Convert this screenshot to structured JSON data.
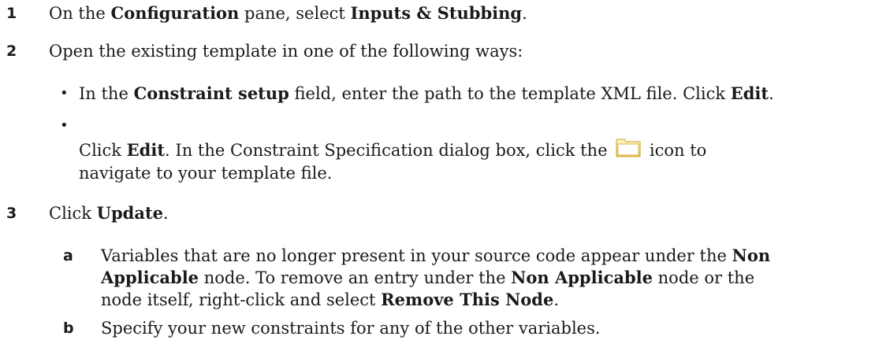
{
  "steps": [
    {
      "number": "1",
      "parts": [
        "On the ",
        "Configuration",
        " pane, select ",
        "Inputs & Stubbing",
        "."
      ]
    },
    {
      "number": "2",
      "text": "Open the existing template in one of the following ways:",
      "bullets": [
        {
          "parts": [
            "In the ",
            "Constraint setup",
            " field, enter the path to the template XML file. Click ",
            "Edit",
            "."
          ]
        },
        {
          "line1": [
            "Click ",
            "Edit",
            ". In the Constraint Specification dialog box, click the ",
            " icon to"
          ],
          "line2": "navigate to your template file."
        }
      ]
    },
    {
      "number": "3",
      "parts": [
        "Click ",
        "Update",
        "."
      ],
      "substeps": [
        {
          "letter": "a",
          "line1": [
            "Variables that are no longer present in your source code appear under the ",
            "Non"
          ],
          "line2": [
            "Applicable",
            " node. To remove an entry under the ",
            "Non Applicable",
            " node or the"
          ],
          "line3": [
            "node itself, right-click and select ",
            "Remove This Node",
            "."
          ]
        },
        {
          "letter": "b",
          "text": "Specify your new constraints for any of the other variables."
        }
      ]
    }
  ],
  "icons": {
    "folder": "folder-icon"
  }
}
